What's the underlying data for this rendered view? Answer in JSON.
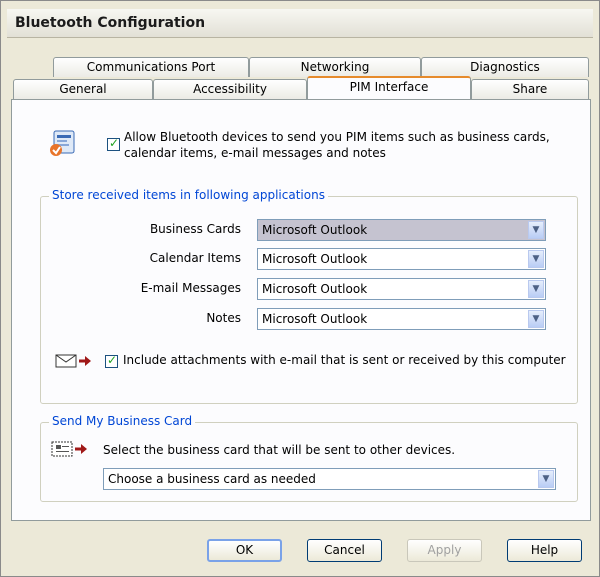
{
  "window": {
    "title": "Bluetooth Configuration"
  },
  "tabs": {
    "row1": [
      "Communications Port",
      "Networking",
      "Diagnostics"
    ],
    "row2": [
      "General",
      "Accessibility",
      "PIM Interface",
      "Share"
    ],
    "active": "PIM Interface"
  },
  "pim": {
    "allow_label_line1": "Allow Bluetooth devices to send you PIM items such as business cards,",
    "allow_label_line2": "calendar items, e-mail messages and notes",
    "allow_checked": true
  },
  "store": {
    "group_title": "Store received items in following applications",
    "rows": [
      {
        "label": "Business Cards",
        "value": "Microsoft Outlook"
      },
      {
        "label": "Calendar Items",
        "value": "Microsoft Outlook"
      },
      {
        "label": "E-mail Messages",
        "value": "Microsoft Outlook"
      },
      {
        "label": "Notes",
        "value": "Microsoft Outlook"
      }
    ],
    "attachments_label": "Include attachments with e-mail that is sent or received by this computer",
    "attachments_checked": true
  },
  "send_card": {
    "group_title": "Send My Business Card",
    "instruction": "Select the business card that will be sent to other devices.",
    "value": "Choose a business card as needed"
  },
  "buttons": {
    "ok": "OK",
    "cancel": "Cancel",
    "apply": "Apply",
    "help": "Help"
  }
}
